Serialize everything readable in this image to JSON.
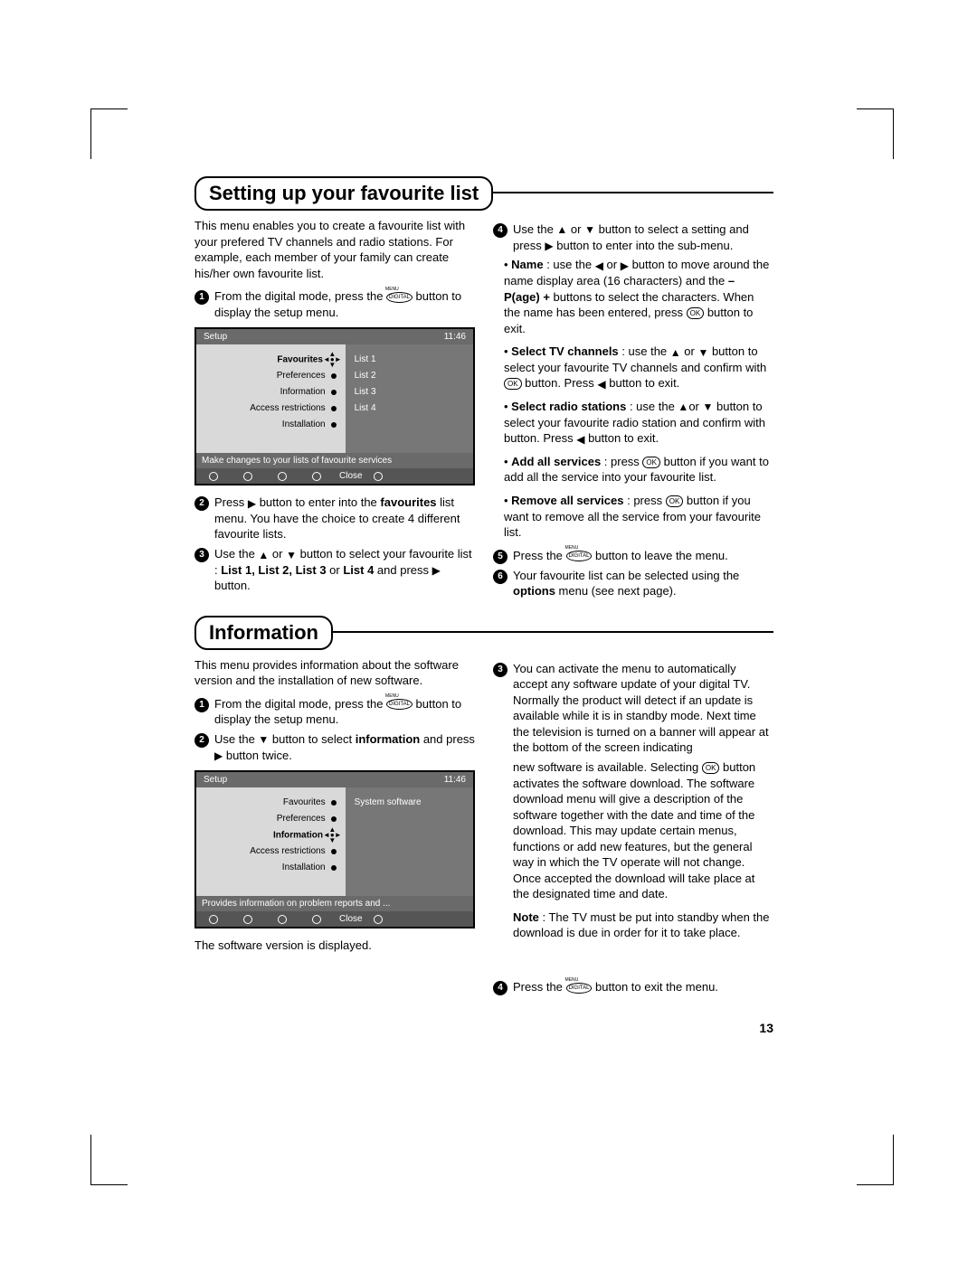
{
  "page_number": "13",
  "sec1": {
    "title": "Setting up your favourite list",
    "intro": "This menu enables you to create a favourite list with your prefered TV channels and radio stations. For example, each member of your family can create his/her own favourite list.",
    "s1a": "From the digital mode, press the ",
    "s1b": " button to display the setup menu.",
    "s2a": "Press ",
    "s2b": " button to enter into the ",
    "s2c": "favourites",
    "s2d": " list menu. You have the choice to create 4 different favourite lists.",
    "s3a": "Use the ",
    "s3b": " or ",
    "s3c": " button to select your favourite list : ",
    "s3d": "List 1, List 2, List 3",
    "s3e": " or ",
    "s3f": "List 4",
    "s3g": " and press ",
    "s3h": " button.",
    "s4a": "Use the ",
    "s4b": " or ",
    "s4c": " button to select a setting and press ",
    "s4d": " button to enter into the sub-menu.",
    "b1_t": "Name",
    "b1a": " : use the ",
    "b1b": " or ",
    "b1c": " button to move around the  name display area (16 characters) and the ",
    "b1d": "– P(age) +",
    "b1e": " buttons to select the characters. When the name has been entered, press ",
    "b1f": " button to exit.",
    "b2_t": "Select TV channels",
    "b2a": " : use the ",
    "b2b": " or ",
    "b2c": " button to select your favourite TV channels and confirm with ",
    "b2d": " button. Press ",
    "b2e": " button to exit.",
    "b3_t": "Select radio stations",
    "b3a": " : use the ",
    "b3b": "or ",
    "b3c": " button to select your favourite radio station and confirm with  button. Press ",
    "b3d": " button to exit.",
    "b4_t": "Add all services",
    "b4a": " : press ",
    "b4b": " button if you want to add all the service into your favourite list.",
    "b5_t": "Remove all services",
    "b5a": " : press ",
    "b5b": " button if you want to remove all the service from your favourite list.",
    "s5a": "Press the ",
    "s5b": " button to leave the menu.",
    "s6a": "Your favourite list can be selected using the ",
    "s6b": "options",
    "s6c": " menu (see next page)."
  },
  "tv1": {
    "title": "Setup",
    "time": "11:46",
    "L": [
      "Favourites",
      "Preferences",
      "Information",
      "Access restrictions",
      "Installation"
    ],
    "R": [
      "List 1",
      "List 2",
      "List 3",
      "List 4"
    ],
    "hint": "Make changes to your lists of favourite services",
    "close": "Close"
  },
  "sec2": {
    "title": "Information",
    "intro": "This menu provides information about the software version and the installation of new software.",
    "s1a": "From the digital mode, press the ",
    "s1b": " button to display the setup menu.",
    "s2a": "Use the ",
    "s2b": " button to select ",
    "s2c": "information",
    "s2d": " and press ",
    "s2e": " button twice.",
    "caption": "The software version is displayed.",
    "s3": "You can activate the menu to automatically accept any software update of your digital TV. Normally the product will detect if an update is available while it is in standby mode. Next time the television is turned on a banner will appear at the bottom of the screen indicating",
    "s3b": "new software is available. Selecting ",
    "s3c": " button activates the software download. The software download menu will give a description of the software together with the date and time of the download. This may update certain menus, functions or add new features, but the general way in which the TV operate will not change. Once accepted the download will take place at the designated time and date.",
    "note_t": "Note",
    "note": " : The TV must be put into standby when the download is due in order for it to take place.",
    "s4a": "Press the ",
    "s4b": "  button to exit the menu."
  },
  "tv2": {
    "title": "Setup",
    "time": "11:46",
    "L": [
      "Favourites",
      "Preferences",
      "Information",
      "Access restrictions",
      "Installation"
    ],
    "R": [
      "System software"
    ],
    "hint": "Provides information on problem reports and ...",
    "close": "Close"
  }
}
